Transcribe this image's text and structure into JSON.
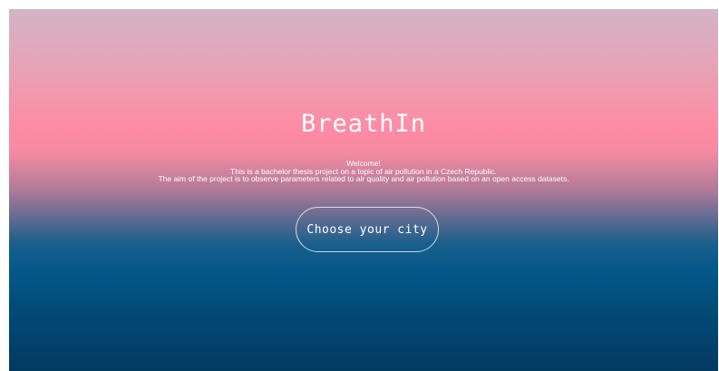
{
  "page": {
    "title": "BreathIn",
    "intro": {
      "line1": "Welcome!",
      "line2": "This is a bachelor thesis project on a topic of air pollution in a Czech Republic.",
      "line3": "The aim of the project is to observe parameters related to air quality and air pollution based on an open access datasets."
    },
    "cta_label": "Choose your city"
  },
  "colors": {
    "gradient_top": "#d3b4c6",
    "gradient_pink": "#ff8aa3",
    "gradient_blue": "#04588a",
    "gradient_bottom": "#023a62",
    "text": "#ffffff"
  }
}
